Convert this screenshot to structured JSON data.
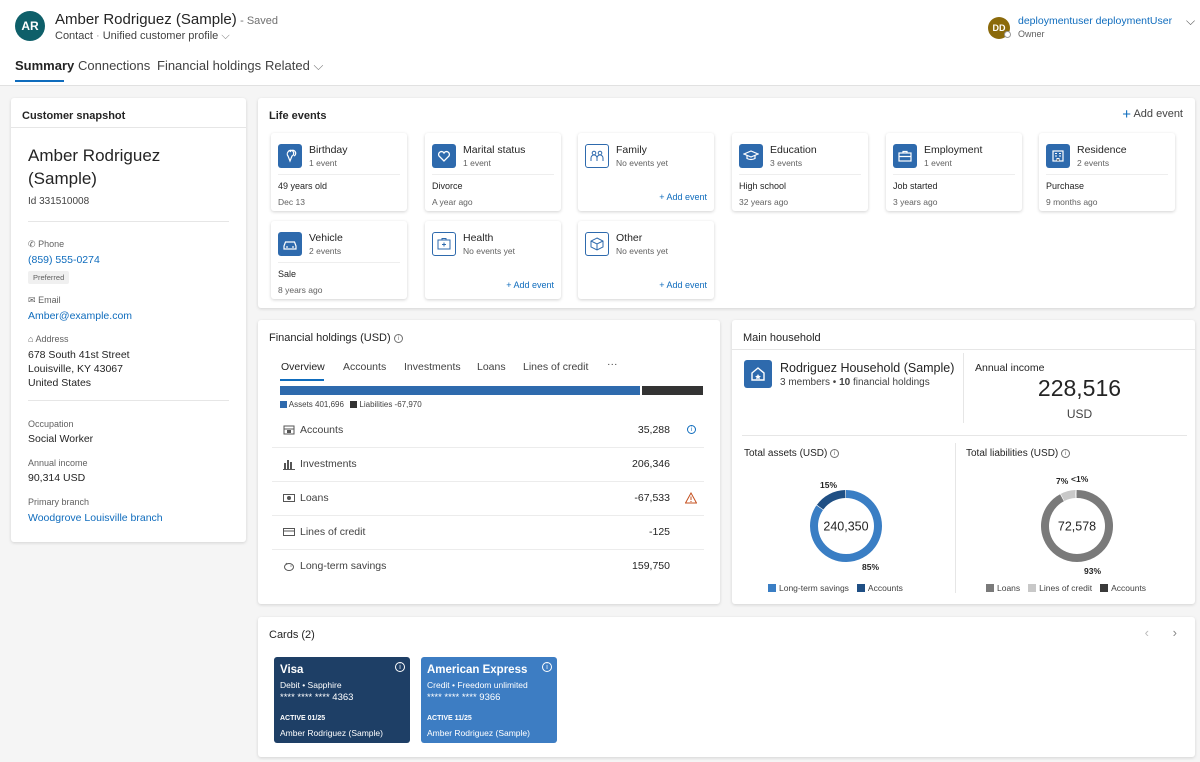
{
  "header": {
    "avatar": "AR",
    "title": "Amber Rodriguez (Sample)",
    "saved": "- Saved",
    "entity": "Contact",
    "form": "Unified customer profile",
    "user_avatar": "DD",
    "user_name": "deploymentuser deploymentUser",
    "user_role": "Owner",
    "tabs": [
      "Summary",
      "Connections",
      "Financial holdings",
      "Related"
    ]
  },
  "snapshot": {
    "title": "Customer snapshot",
    "name_line1": "Amber Rodriguez",
    "name_line2": "(Sample)",
    "id": "Id 331510008",
    "phone_label": "Phone",
    "phone": "(859) 555-0274",
    "preferred": "Preferred",
    "email_label": "Email",
    "email": "Amber@example.com",
    "address_label": "Address",
    "address1": "678 South 41st Street",
    "address2": "Louisville, KY 43067",
    "address3": "United States",
    "occupation_label": "Occupation",
    "occupation": "Social Worker",
    "income_label": "Annual income",
    "income": "90,314 USD",
    "branch_label": "Primary branch",
    "branch": "Woodgrove Louisville branch"
  },
  "life_events": {
    "title": "Life events",
    "add": "Add event",
    "items": [
      {
        "name": "Birthday",
        "count": "1 event",
        "v1": "49 years old",
        "v2": "Dec 13",
        "icon": "birthday-icon"
      },
      {
        "name": "Marital status",
        "count": "1 event",
        "v1": "Divorce",
        "v2": "A year ago",
        "icon": "heart-icon"
      },
      {
        "name": "Family",
        "count": "No events yet",
        "add": "+ Add event",
        "icon": "family-icon"
      },
      {
        "name": "Education",
        "count": "3 events",
        "v1": "High school",
        "v2": "32 years ago",
        "icon": "graduation-icon"
      },
      {
        "name": "Employment",
        "count": "1 event",
        "v1": "Job started",
        "v2": "3 years ago",
        "icon": "briefcase-icon"
      },
      {
        "name": "Residence",
        "count": "2 events",
        "v1": "Purchase",
        "v2": "9 months ago",
        "icon": "building-icon"
      },
      {
        "name": "Vehicle",
        "count": "2 events",
        "v1": "Sale",
        "v2": "8 years ago",
        "icon": "car-icon"
      },
      {
        "name": "Health",
        "count": "No events yet",
        "add": "+ Add event",
        "icon": "health-icon"
      },
      {
        "name": "Other",
        "count": "No events yet",
        "add": "+ Add event",
        "icon": "box-icon"
      }
    ]
  },
  "financial": {
    "title": "Financial holdings (USD)",
    "tabs": [
      "Overview",
      "Accounts",
      "Investments",
      "Loans",
      "Lines of credit",
      "···"
    ],
    "assets_legend": "Assets 401,696",
    "liabilities_legend": "Liabilities -67,970",
    "assets_value": 401696,
    "liabilities_value": 67970,
    "rows": [
      {
        "label": "Accounts",
        "value": "35,288"
      },
      {
        "label": "Investments",
        "value": "206,346"
      },
      {
        "label": "Loans",
        "value": "-67,533"
      },
      {
        "label": "Lines of credit",
        "value": "-125"
      },
      {
        "label": "Long-term savings",
        "value": "159,750"
      }
    ]
  },
  "household": {
    "title": "Main household",
    "name": "Rodriguez Household (Sample)",
    "members": "3 members",
    "bullet": "•",
    "holdings_count": "10",
    "holdings_label": "financial holdings",
    "income_label": "Annual income",
    "income": "228,516",
    "currency": "USD",
    "assets_title": "Total assets (USD)",
    "liabilities_title": "Total liabilities (USD)"
  },
  "chart_data": [
    {
      "type": "pie",
      "title": "Total assets (USD)",
      "center_label": "240,350",
      "labels": [
        "Long-term savings",
        "Accounts"
      ],
      "values": [
        85,
        15
      ],
      "data_labels": [
        "85%",
        "15%"
      ],
      "colors": [
        "#3a7ec4",
        "#1f4f84"
      ]
    },
    {
      "type": "pie",
      "title": "Total liabilities (USD)",
      "center_label": "72,578",
      "labels": [
        "Loans",
        "Lines of credit",
        "Accounts"
      ],
      "values": [
        93,
        7,
        0.5
      ],
      "data_labels": [
        "93%",
        "7%",
        "<1%"
      ],
      "colors": [
        "#7a7a7a",
        "#c8c8c8",
        "#3a3a3a"
      ]
    }
  ],
  "cards": {
    "title": "Cards (2)",
    "items": [
      {
        "name": "Visa",
        "type": "Debit • Sapphire",
        "number": "**** **** **** 4363",
        "active": "ACTIVE 01/25",
        "owner": "Amber Rodriguez (Sample)",
        "color": "#1e3f66"
      },
      {
        "name": "American Express",
        "type": "Credit • Freedom unlimited",
        "number": "**** **** **** 9366",
        "active": "ACTIVE 11/25",
        "owner": "Amber Rodriguez (Sample)",
        "color": "#3d7dc3"
      }
    ]
  },
  "colors": {
    "accent": "#0f6cbd",
    "icon_blue": "#2e6aad",
    "assets_bar": "#2e6aad",
    "liabilities_bar": "#333333"
  }
}
